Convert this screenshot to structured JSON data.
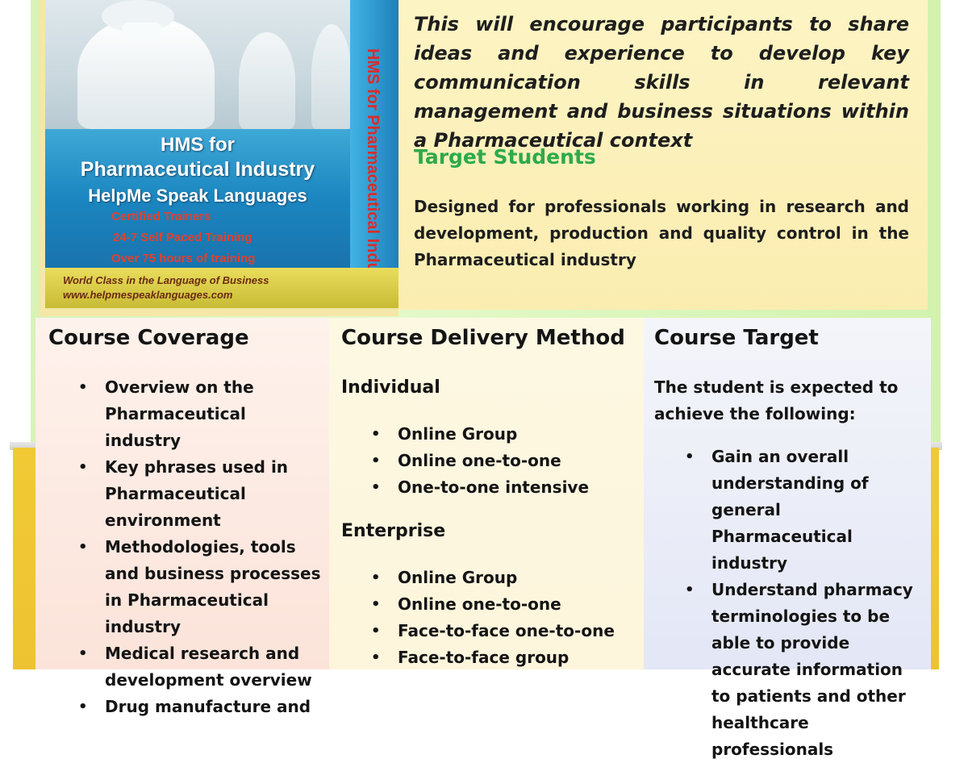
{
  "product_box": {
    "title_line1": "HMS for",
    "title_line2": "Pharmaceutical Industry",
    "title_line3": "HelpMe Speak Languages",
    "features": [
      "Certified Trainers",
      "24-7 Self Paced Training",
      "Over 75 hours of training"
    ],
    "side_text": "HMS for Pharmaceutical Industry",
    "tagline": "World Class in the Language of Business",
    "website": "www.helpmespeaklanguages.com"
  },
  "intro": {
    "text": "This will encourage participants to share ideas and experience to develop key communication skills in relevant management and business situations within a Pharmaceutical context"
  },
  "target_students": {
    "heading": "Target Students",
    "description": "Designed for professionals working in research and development, production and quality control in the Pharmaceutical industry"
  },
  "course_coverage": {
    "heading": "Course Coverage",
    "items": [
      "Overview on the Pharmaceutical industry",
      "Key phrases used in Pharmaceutical environment",
      "Methodologies, tools and business processes  in Pharmaceutical industry",
      "Medical research and development overview",
      "Drug manufacture and"
    ]
  },
  "course_delivery": {
    "heading": "Course Delivery Method",
    "individual_heading": "Individual",
    "individual_items": [
      "Online Group",
      "Online one-to-one",
      "One-to-one intensive"
    ],
    "enterprise_heading": "Enterprise",
    "enterprise_items": [
      "Online Group",
      "Online one-to-one",
      "Face-to-face one-to-one",
      "Face-to-face group"
    ]
  },
  "course_target": {
    "heading": "Course Target",
    "intro": "The student is expected to achieve the following:",
    "items": [
      "Gain an overall understanding of general Pharmaceutical industry",
      "Understand pharmacy terminologies to be able to provide accurate information to  patients and other healthcare professionals"
    ]
  },
  "colors": {
    "green_heading": "#2daa4b",
    "green_panel": "#d7f4b6",
    "yellow_panel": "#f1c935"
  }
}
